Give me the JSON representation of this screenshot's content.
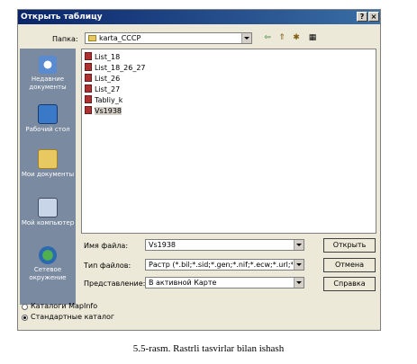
{
  "dialog": {
    "title": "Открыть таблицу",
    "help_label": "?",
    "close_label": "×"
  },
  "folder": {
    "label": "Папка:",
    "value": "karta_CCCP"
  },
  "toolbar": {
    "back_glyph": "⇦",
    "up_glyph": "⇑",
    "newfolder_glyph": "✱",
    "view_glyph": "▦"
  },
  "places": [
    {
      "label": "Недавние документы",
      "icon": "recent-documents-icon"
    },
    {
      "label": "Рабочий стол",
      "icon": "desktop-icon"
    },
    {
      "label": "Мои документы",
      "icon": "my-documents-icon"
    },
    {
      "label": "Мой компьютер",
      "icon": "my-computer-icon"
    },
    {
      "label": "Сетевое окружение",
      "icon": "network-icon"
    }
  ],
  "files": [
    {
      "name": "List_18",
      "selected": false
    },
    {
      "name": "List_18_26_27",
      "selected": false
    },
    {
      "name": "List_26",
      "selected": false
    },
    {
      "name": "List_27",
      "selected": false
    },
    {
      "name": "Tabliy_k",
      "selected": false
    },
    {
      "name": "Vs1938",
      "selected": true
    }
  ],
  "fields": {
    "filename_label": "Имя файла:",
    "filename_value": "Vs1938",
    "filetype_label": "Тип файлов:",
    "filetype_value": "Растр (*.bil;*.sid;*.gen;*.nif;*.ecw;*.url;*.til;*.grc;",
    "view_label": "Представление:",
    "view_value": "В активной Карте"
  },
  "buttons": {
    "open": "Открыть",
    "cancel": "Отмена",
    "help": "Справка"
  },
  "catalog_options": [
    {
      "label": "Каталоги MapInfo",
      "selected": false
    },
    {
      "label": "Стандартные каталог",
      "selected": true
    }
  ],
  "caption": "5.5-rasm. Rastrli tasvirlar bilan ishash",
  "colors": {
    "title_bar_start": "#0a246a",
    "title_bar_end": "#3a6ea5",
    "places_bar": "#7a8aa0",
    "dialog_bg": "#ece9d8"
  }
}
